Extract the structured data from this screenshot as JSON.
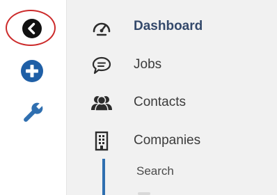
{
  "rail": {
    "buttons": [
      {
        "name": "back",
        "icon": "chevron-left-icon",
        "color": "#111111"
      },
      {
        "name": "add",
        "icon": "plus-circle-icon",
        "color": "#1f5fa6"
      },
      {
        "name": "settings",
        "icon": "wrench-icon",
        "color": "#2f6fb0"
      }
    ],
    "highlight_color": "#cc2b2b"
  },
  "menu": {
    "items": [
      {
        "label": "Dashboard",
        "icon": "speedometer-icon",
        "active": true
      },
      {
        "label": "Jobs",
        "icon": "chat-bubble-icon",
        "active": false
      },
      {
        "label": "Contacts",
        "icon": "people-icon",
        "active": false
      },
      {
        "label": "Companies",
        "icon": "building-icon",
        "active": false
      }
    ],
    "submenu": {
      "items": [
        {
          "label": "Search"
        }
      ],
      "accent_color": "#2f6fb0"
    }
  }
}
